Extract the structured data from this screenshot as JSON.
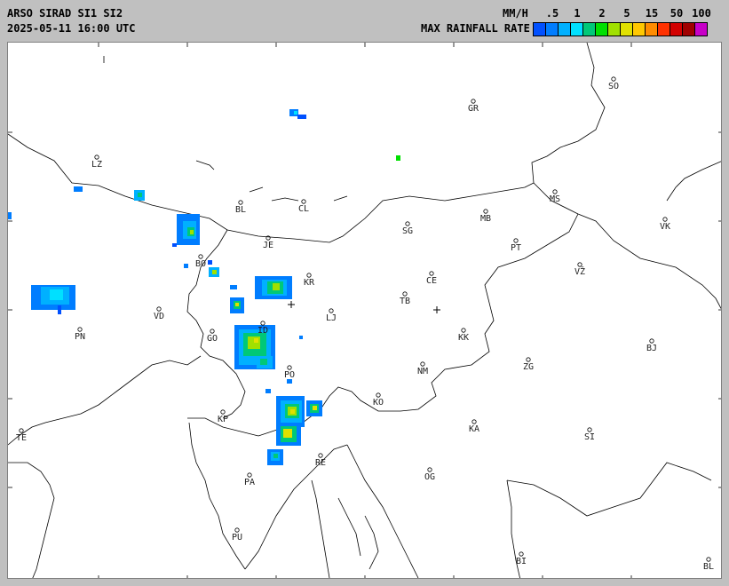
{
  "header": {
    "title_line1": "ARSO SIRAD SI1 SI2",
    "title_line2": "2025-05-11 16:00 UTC",
    "unit": "MM/H",
    "rate_label": "MAX RAINFALL RATE",
    "scale_ticks": [
      ".5",
      "1",
      "2",
      "5",
      "15",
      "50",
      "100"
    ]
  },
  "legend_colors": [
    "#0050ff",
    "#007dff",
    "#00b0ff",
    "#00e0ff",
    "#00c878",
    "#00e000",
    "#a0e000",
    "#e0e000",
    "#ffc800",
    "#ff8c00",
    "#ff3200",
    "#d20000",
    "#a00000",
    "#c800c8"
  ],
  "cities": [
    {
      "label": "SO"
    },
    {
      "label": "GR"
    },
    {
      "label": "LZ"
    },
    {
      "label": "MS"
    },
    {
      "label": "BL"
    },
    {
      "label": "CL"
    },
    {
      "label": "MB"
    },
    {
      "label": "VK"
    },
    {
      "label": "SG"
    },
    {
      "label": "JE"
    },
    {
      "label": "PT"
    },
    {
      "label": "BO"
    },
    {
      "label": "KR"
    },
    {
      "label": "CE"
    },
    {
      "label": "VŽ"
    },
    {
      "label": "VD"
    },
    {
      "label": "TB"
    },
    {
      "label": "LJ"
    },
    {
      "label": "PN"
    },
    {
      "label": "ID"
    },
    {
      "label": "GO"
    },
    {
      "label": "KK"
    },
    {
      "label": "BJ"
    },
    {
      "label": "PO"
    },
    {
      "label": "NM"
    },
    {
      "label": "ZG"
    },
    {
      "label": "KO"
    },
    {
      "label": "KP"
    },
    {
      "label": "KA"
    },
    {
      "label": "TE"
    },
    {
      "label": "SI"
    },
    {
      "label": "RE"
    },
    {
      "label": "OG"
    },
    {
      "label": "PA"
    },
    {
      "label": "PU"
    },
    {
      "label": "BI"
    },
    {
      "label": "BL"
    }
  ]
}
